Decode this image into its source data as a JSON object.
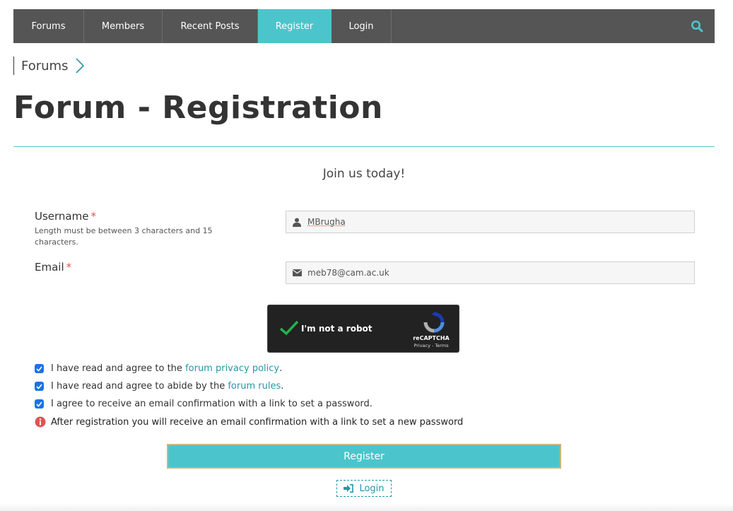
{
  "nav": {
    "items": [
      {
        "label": "Forums",
        "active": false
      },
      {
        "label": "Members",
        "active": false
      },
      {
        "label": "Recent Posts",
        "active": false
      },
      {
        "label": "Register",
        "active": true
      },
      {
        "label": "Login",
        "active": false
      }
    ],
    "search_icon": "search-icon",
    "accent_color": "#4bc5cb",
    "bar_color": "#555555"
  },
  "breadcrumb": {
    "label": "Forums",
    "icon": "chevron-right-icon"
  },
  "page": {
    "title": "Forum - Registration",
    "subtitle": "Join us today!"
  },
  "form": {
    "username": {
      "label": "Username",
      "required_mark": "*",
      "hint": "Length must be between 3 characters and 15 characters.",
      "value": "MBrugha",
      "icon": "user-icon"
    },
    "email": {
      "label": "Email",
      "required_mark": "*",
      "value": "meb78@cam.ac.uk",
      "icon": "envelope-icon"
    },
    "captcha": {
      "label": "I'm not a robot",
      "brand": "reCAPTCHA",
      "links": "Privacy - Terms",
      "checked": true
    },
    "agreements": [
      {
        "prefix": "I have read and agree to the ",
        "link": "forum privacy policy",
        "suffix": ".",
        "checked": true
      },
      {
        "prefix": "I have read and agree to abide by the ",
        "link": "forum rules",
        "suffix": ".",
        "checked": true
      },
      {
        "prefix": "I agree to receive an email confirmation with a link to set a password.",
        "link": "",
        "suffix": "",
        "checked": true
      }
    ],
    "info": "After registration you will receive an email confirmation with a link to set a new password",
    "register_label": "Register",
    "login_label": "Login"
  }
}
